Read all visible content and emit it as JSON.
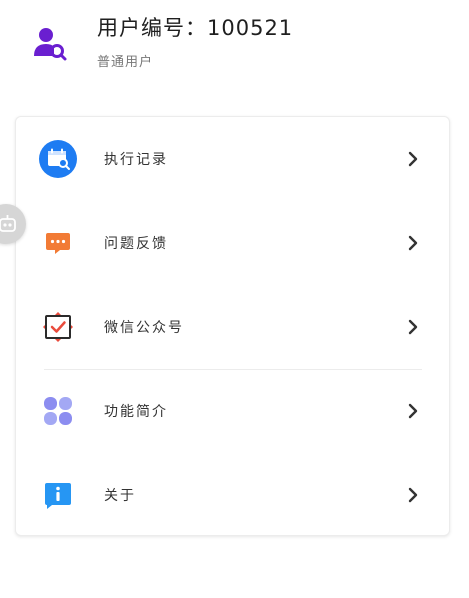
{
  "profile": {
    "user_id_text": "用户编号：100521",
    "user_type": "普通用户"
  },
  "menu": [
    {
      "label": "执行记录",
      "icon": "calendar-search-icon",
      "color": "#1e7cf2"
    },
    {
      "label": "问题反馈",
      "icon": "chat-bubble-icon",
      "color": "#f27b35"
    },
    {
      "label": "微信公众号",
      "icon": "wechat-official-account-icon",
      "color": "#e94b3c"
    },
    {
      "label": "功能简介",
      "icon": "grid-blocks-icon",
      "color": "#8c8df0"
    },
    {
      "label": "关于",
      "icon": "info-icon",
      "color": "#2696f3"
    }
  ],
  "colors": {
    "accent_purple": "#6a1fd0"
  }
}
